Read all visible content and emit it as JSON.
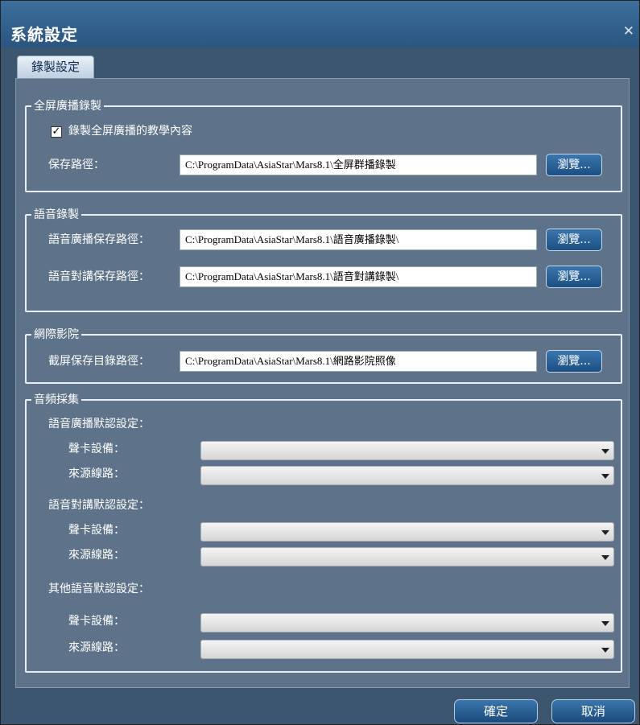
{
  "window": {
    "title": "系統設定"
  },
  "tabs": [
    {
      "label": "錄製設定"
    }
  ],
  "fullscreen": {
    "legend": "全屏廣播錄製",
    "checkbox_label": "錄製全屏廣播的教學內容",
    "checked": true,
    "path_label": "保存路徑：",
    "path_value": "C:\\ProgramData\\AsiaStar\\Mars8.1\\全屏群播錄製",
    "browse_label": "瀏覽..."
  },
  "voice": {
    "legend": "語音錄製",
    "broadcast_label": "語音廣播保存路徑：",
    "broadcast_value": "C:\\ProgramData\\AsiaStar\\Mars8.1\\語音廣播錄製\\",
    "talk_label": "語音對講保存路徑：",
    "talk_value": "C:\\ProgramData\\AsiaStar\\Mars8.1\\語音對講錄製\\",
    "browse_label": "瀏覽..."
  },
  "cinema": {
    "legend": "網際影院",
    "path_label": "截屏保存目錄路徑：",
    "path_value": "C:\\ProgramData\\AsiaStar\\Mars8.1\\網路影院照像",
    "browse_label": "瀏覽..."
  },
  "audio": {
    "legend": "音頻採集",
    "groups": [
      {
        "title": "語音廣播默認設定：",
        "card_label": "聲卡設備：",
        "card_value": "",
        "line_label": "來源線路：",
        "line_value": ""
      },
      {
        "title": "語音對講默認設定：",
        "card_label": "聲卡設備：",
        "card_value": "",
        "line_label": "來源線路：",
        "line_value": ""
      },
      {
        "title": "其他語音默認設定：",
        "card_label": "聲卡設備：",
        "card_value": "",
        "line_label": "來源線路：",
        "line_value": ""
      }
    ]
  },
  "footer": {
    "ok_label": "確定",
    "cancel_label": "取消"
  }
}
